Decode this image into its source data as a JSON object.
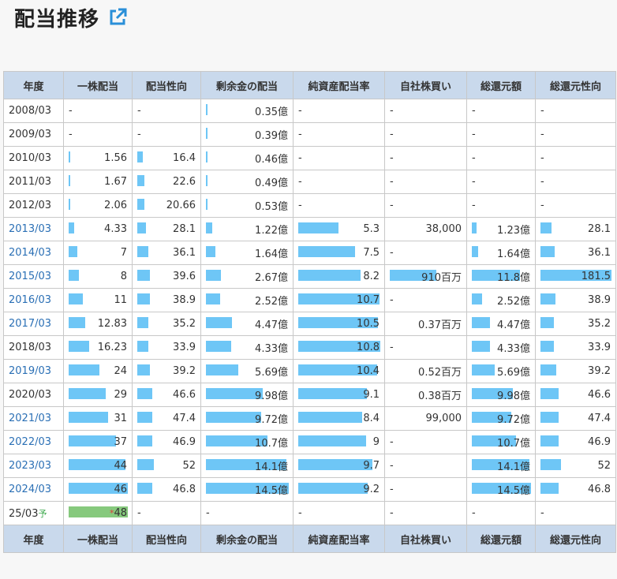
{
  "title": "配当推移",
  "headers": [
    "年度",
    "一株配当",
    "配当性向",
    "剰余金の配当",
    "純資産配当率",
    "自社株買い",
    "総還元額",
    "総還元性向"
  ],
  "forecast_mark": "予",
  "forecast_star": "*",
  "colors": {
    "bar": "#6ec6f6",
    "forecast_bar": "#86c97d",
    "header_bg": "#c9d9ec",
    "link": "#2a6fb5",
    "accent": "#2a8fd8"
  },
  "rows": [
    {
      "year": "2008/03",
      "link": false,
      "cells": [
        {
          "text": "-"
        },
        {
          "text": "-"
        },
        {
          "text": "0.35億",
          "bar": 0.01
        },
        {
          "text": "-"
        },
        {
          "text": "-"
        },
        {
          "text": "-"
        },
        {
          "text": "-"
        }
      ]
    },
    {
      "year": "2009/03",
      "link": false,
      "cells": [
        {
          "text": "-"
        },
        {
          "text": "-"
        },
        {
          "text": "0.39億",
          "bar": 0.01
        },
        {
          "text": "-"
        },
        {
          "text": "-"
        },
        {
          "text": "-"
        },
        {
          "text": "-"
        }
      ]
    },
    {
      "year": "2010/03",
      "link": false,
      "cells": [
        {
          "text": "1.56",
          "bar": 0.03
        },
        {
          "text": "16.4",
          "bar": 0.09
        },
        {
          "text": "0.46億",
          "bar": 0.01
        },
        {
          "text": "-"
        },
        {
          "text": "-"
        },
        {
          "text": "-"
        },
        {
          "text": "-"
        }
      ]
    },
    {
      "year": "2011/03",
      "link": false,
      "cells": [
        {
          "text": "1.67",
          "bar": 0.03
        },
        {
          "text": "22.6",
          "bar": 0.12
        },
        {
          "text": "0.49億",
          "bar": 0.01
        },
        {
          "text": "-"
        },
        {
          "text": "-"
        },
        {
          "text": "-"
        },
        {
          "text": "-"
        }
      ]
    },
    {
      "year": "2012/03",
      "link": false,
      "cells": [
        {
          "text": "2.06",
          "bar": 0.03
        },
        {
          "text": "20.66",
          "bar": 0.12
        },
        {
          "text": "0.53億",
          "bar": 0.01
        },
        {
          "text": "-"
        },
        {
          "text": "-"
        },
        {
          "text": "-"
        },
        {
          "text": "-"
        }
      ]
    },
    {
      "year": "2013/03",
      "link": true,
      "cells": [
        {
          "text": "4.33",
          "bar": 0.09
        },
        {
          "text": "28.1",
          "bar": 0.15
        },
        {
          "text": "1.22億",
          "bar": 0.08
        },
        {
          "text": "5.3",
          "bar": 0.49
        },
        {
          "text": "38,000"
        },
        {
          "text": "1.23億",
          "bar": 0.08
        },
        {
          "text": "28.1",
          "bar": 0.15
        }
      ]
    },
    {
      "year": "2014/03",
      "link": true,
      "cells": [
        {
          "text": "7",
          "bar": 0.15
        },
        {
          "text": "36.1",
          "bar": 0.19
        },
        {
          "text": "1.64億",
          "bar": 0.11
        },
        {
          "text": "7.5",
          "bar": 0.69
        },
        {
          "text": "-"
        },
        {
          "text": "1.64億",
          "bar": 0.11
        },
        {
          "text": "36.1",
          "bar": 0.2
        }
      ]
    },
    {
      "year": "2015/03",
      "link": true,
      "cells": [
        {
          "text": "8",
          "bar": 0.17
        },
        {
          "text": "39.6",
          "bar": 0.21
        },
        {
          "text": "2.67億",
          "bar": 0.18
        },
        {
          "text": "8.2",
          "bar": 0.76
        },
        {
          "text": "910百万",
          "bar": 0.64
        },
        {
          "text": "11.8億",
          "bar": 0.81
        },
        {
          "text": "181.5",
          "bar": 1.0
        }
      ]
    },
    {
      "year": "2016/03",
      "link": true,
      "cells": [
        {
          "text": "11",
          "bar": 0.24
        },
        {
          "text": "38.9",
          "bar": 0.21
        },
        {
          "text": "2.52億",
          "bar": 0.17
        },
        {
          "text": "10.7",
          "bar": 0.99
        },
        {
          "text": "-"
        },
        {
          "text": "2.52億",
          "bar": 0.17
        },
        {
          "text": "38.9",
          "bar": 0.21
        }
      ]
    },
    {
      "year": "2017/03",
      "link": true,
      "cells": [
        {
          "text": "12.83",
          "bar": 0.28
        },
        {
          "text": "35.2",
          "bar": 0.19
        },
        {
          "text": "4.47億",
          "bar": 0.31
        },
        {
          "text": "10.5",
          "bar": 0.97
        },
        {
          "text": "0.37百万"
        },
        {
          "text": "4.47億",
          "bar": 0.31
        },
        {
          "text": "35.2",
          "bar": 0.19
        }
      ]
    },
    {
      "year": "2018/03",
      "link": false,
      "cells": [
        {
          "text": "16.23",
          "bar": 0.35
        },
        {
          "text": "33.9",
          "bar": 0.18
        },
        {
          "text": "4.33億",
          "bar": 0.3
        },
        {
          "text": "10.8",
          "bar": 1.0
        },
        {
          "text": "-"
        },
        {
          "text": "4.33億",
          "bar": 0.3
        },
        {
          "text": "33.9",
          "bar": 0.19
        }
      ]
    },
    {
      "year": "2019/03",
      "link": true,
      "cells": [
        {
          "text": "24",
          "bar": 0.52
        },
        {
          "text": "39.2",
          "bar": 0.21
        },
        {
          "text": "5.69億",
          "bar": 0.39
        },
        {
          "text": "10.4",
          "bar": 0.96
        },
        {
          "text": "0.52百万"
        },
        {
          "text": "5.69億",
          "bar": 0.39
        },
        {
          "text": "39.2",
          "bar": 0.22
        }
      ]
    },
    {
      "year": "2020/03",
      "link": false,
      "cells": [
        {
          "text": "29",
          "bar": 0.63
        },
        {
          "text": "46.6",
          "bar": 0.25
        },
        {
          "text": "9.98億",
          "bar": 0.69
        },
        {
          "text": "9.1",
          "bar": 0.84
        },
        {
          "text": "0.38百万"
        },
        {
          "text": "9.98億",
          "bar": 0.69
        },
        {
          "text": "46.6",
          "bar": 0.26
        }
      ]
    },
    {
      "year": "2021/03",
      "link": true,
      "cells": [
        {
          "text": "31",
          "bar": 0.67
        },
        {
          "text": "47.4",
          "bar": 0.25
        },
        {
          "text": "9.72億",
          "bar": 0.67
        },
        {
          "text": "8.4",
          "bar": 0.78
        },
        {
          "text": "99,000"
        },
        {
          "text": "9.72億",
          "bar": 0.67
        },
        {
          "text": "47.4",
          "bar": 0.26
        }
      ]
    },
    {
      "year": "2022/03",
      "link": true,
      "cells": [
        {
          "text": "37",
          "bar": 0.8
        },
        {
          "text": "46.9",
          "bar": 0.25
        },
        {
          "text": "10.7億",
          "bar": 0.74
        },
        {
          "text": "9",
          "bar": 0.83
        },
        {
          "text": "-"
        },
        {
          "text": "10.7億",
          "bar": 0.74
        },
        {
          "text": "46.9",
          "bar": 0.26
        }
      ]
    },
    {
      "year": "2023/03",
      "link": true,
      "cells": [
        {
          "text": "44",
          "bar": 0.96
        },
        {
          "text": "52",
          "bar": 0.28
        },
        {
          "text": "14.1億",
          "bar": 0.97
        },
        {
          "text": "9.7",
          "bar": 0.9
        },
        {
          "text": "-"
        },
        {
          "text": "14.1億",
          "bar": 0.97
        },
        {
          "text": "52",
          "bar": 0.29
        }
      ]
    },
    {
      "year": "2024/03",
      "link": true,
      "cells": [
        {
          "text": "46",
          "bar": 1.0
        },
        {
          "text": "46.8",
          "bar": 0.25
        },
        {
          "text": "14.5億",
          "bar": 1.0
        },
        {
          "text": "9.2",
          "bar": 0.85
        },
        {
          "text": "-"
        },
        {
          "text": "14.5億",
          "bar": 1.0
        },
        {
          "text": "46.8",
          "bar": 0.26
        }
      ]
    },
    {
      "year": "25/03",
      "link": false,
      "forecast": true,
      "cells": [
        {
          "text": "48",
          "bar": 1.0,
          "green": true,
          "star": true
        },
        {
          "text": "-"
        },
        {
          "text": "-"
        },
        {
          "text": "-"
        },
        {
          "text": "-"
        },
        {
          "text": "-"
        },
        {
          "text": "-"
        }
      ]
    }
  ]
}
